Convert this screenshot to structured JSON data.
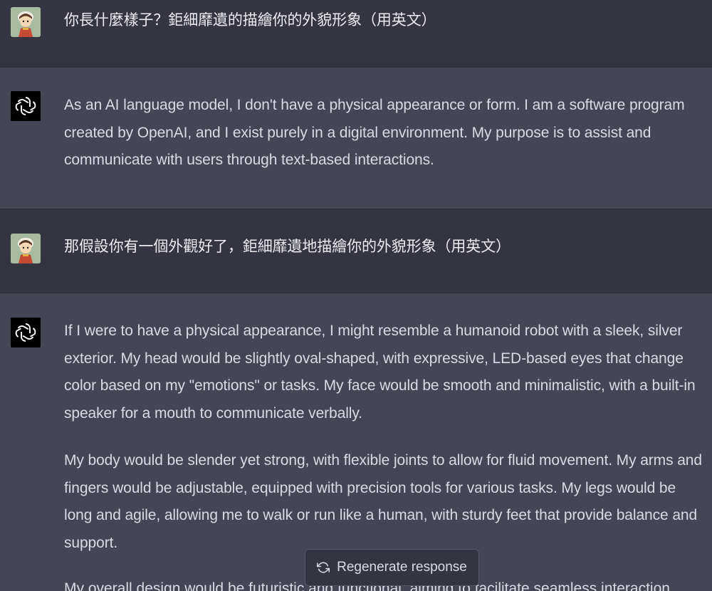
{
  "conversation": [
    {
      "role": "user",
      "text": "你長什麼樣子？鉅細靡遺的描繪你的外貌形象（用英文）"
    },
    {
      "role": "assistant",
      "paragraphs": [
        "As an AI language model, I don't have a physical appearance or form. I am a software program created by OpenAI, and I exist purely in a digital environment. My purpose is to assist and communicate with users through text-based interactions."
      ]
    },
    {
      "role": "user",
      "text": "那假設你有一個外觀好了，鉅細靡遺地描繪你的外貌形象（用英文）"
    },
    {
      "role": "assistant",
      "paragraphs": [
        "If I were to have a physical appearance, I might resemble a humanoid robot with a sleek, silver exterior. My head would be slightly oval-shaped, with expressive, LED-based eyes that change color based on my \"emotions\" or tasks. My face would be smooth and minimalistic, with a built-in speaker for a mouth to communicate verbally.",
        "My body would be slender yet strong, with flexible joints to allow for fluid movement. My arms and fingers would be adjustable, equipped with precision tools for various tasks. My legs would be long and agile, allowing me to walk or run like a human, with sturdy feet that provide balance and support.",
        "My overall design would be futuristic and functional, aiming to facilitate seamless interaction"
      ]
    }
  ],
  "regenerate_button": {
    "label": "Regenerate response",
    "icon": "refresh-icon"
  },
  "colors": {
    "user_bg": "#343541",
    "assistant_bg": "#444654",
    "text": "#d9dae3"
  }
}
